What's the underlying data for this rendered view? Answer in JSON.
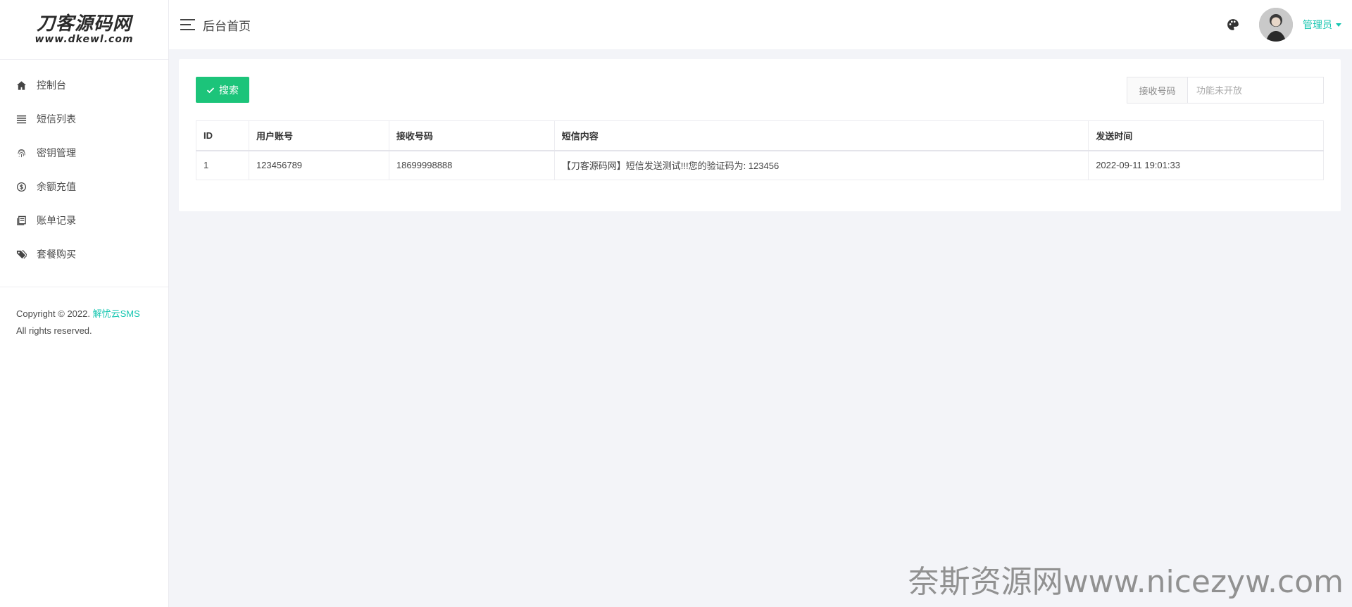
{
  "logo": {
    "main": "刀客源码网",
    "sub": "www.dkewl.com"
  },
  "sidebar": {
    "items": [
      {
        "label": "控制台",
        "icon": "home-icon"
      },
      {
        "label": "短信列表",
        "icon": "list-icon"
      },
      {
        "label": "密钥管理",
        "icon": "fingerprint-icon"
      },
      {
        "label": "余额充值",
        "icon": "dollar-circle-icon"
      },
      {
        "label": "账单记录",
        "icon": "book-icon"
      },
      {
        "label": "套餐购买",
        "icon": "tags-icon"
      }
    ],
    "copyright_prefix": "Copyright © 2022.",
    "copyright_brand": "解忧云SMS",
    "copyright_suffix": "All rights reserved."
  },
  "header": {
    "title": "后台首页",
    "user_name": "管理员",
    "palette_icon": "palette-icon",
    "menu_icon": "hamburger-icon"
  },
  "toolbar": {
    "search_label": "搜索",
    "filter_label": "接收号码",
    "filter_placeholder": "功能未开放"
  },
  "table": {
    "columns": [
      "ID",
      "用户账号",
      "接收号码",
      "短信内容",
      "发送时间"
    ],
    "rows": [
      [
        "1",
        "123456789",
        "18699998888",
        "【刀客源码网】短信发送测试!!!您的验证码为: 123456",
        "2022-09-11 19:01:33"
      ]
    ]
  },
  "watermark": "奈斯资源网www.nicezyw.com",
  "colors": {
    "accent": "#16c6b0",
    "success": "#1cc47a",
    "background": "#f3f4f8"
  }
}
